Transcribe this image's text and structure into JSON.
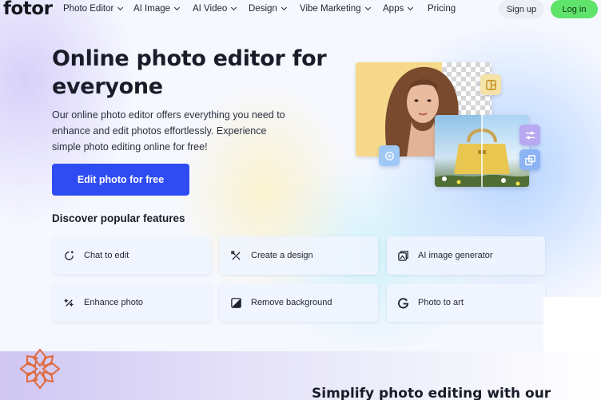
{
  "nav": {
    "logo": "fotor",
    "items": [
      {
        "label": "Photo Editor",
        "has_dropdown": true
      },
      {
        "label": "AI Image",
        "has_dropdown": true
      },
      {
        "label": "AI Video",
        "has_dropdown": true
      },
      {
        "label": "Design",
        "has_dropdown": true
      },
      {
        "label": "Vibe Marketing",
        "has_dropdown": true
      },
      {
        "label": "Apps",
        "has_dropdown": true
      },
      {
        "label": "Pricing",
        "has_dropdown": false
      }
    ],
    "signup": "Sign up",
    "login": "Log in"
  },
  "hero": {
    "title_line1": "Online photo editor for",
    "title_line2": "everyone",
    "desc_line1": "Our online photo editor offers everything you need to",
    "desc_line2": "enhance and edit photos effortlessly. Experience",
    "desc_line3": "simple photo editing online for free!",
    "cta": "Edit photo for free"
  },
  "features": {
    "heading": "Discover popular features",
    "items": [
      {
        "label": "Chat to edit",
        "icon": "chat-edit-icon"
      },
      {
        "label": "Create a design",
        "icon": "design-tools-icon"
      },
      {
        "label": "AI image generator",
        "icon": "ai-image-icon"
      },
      {
        "label": "Enhance photo",
        "icon": "sparkle-enhance-icon"
      },
      {
        "label": "Remove background",
        "icon": "remove-bg-icon"
      },
      {
        "label": "Photo to art",
        "icon": "art-g-icon"
      }
    ]
  },
  "band": {
    "title": "Simplify photo editing with our"
  },
  "colors": {
    "accent": "#2f4cf3",
    "login": "#5fe36a",
    "ornament": "#e0693a"
  }
}
